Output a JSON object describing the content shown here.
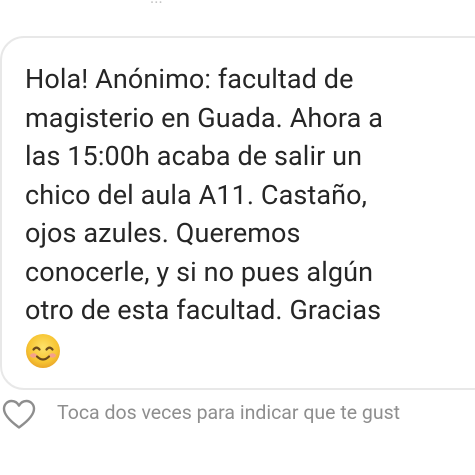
{
  "header": {
    "cutoff_text": "..."
  },
  "message": {
    "lines": [
      "Hola! Anónimo: facultad de",
      "magisterio en Guada. Ahora a",
      "las 15:00h acaba de salir un",
      "chico del aula A11. Castaño,",
      "ojos azules. Queremos",
      "conocerle, y si no pues algún",
      "otro  de esta facultad. Gracias"
    ],
    "emoji": "smiling-face-emoji"
  },
  "like": {
    "icon": "heart-outline-icon",
    "hint": "Toca dos veces para indicar que te gust"
  },
  "colors": {
    "text": "#262626",
    "hint": "#8e8e8e",
    "bubble_border": "#e8e8e8",
    "emoji_face": "#f7c533"
  }
}
